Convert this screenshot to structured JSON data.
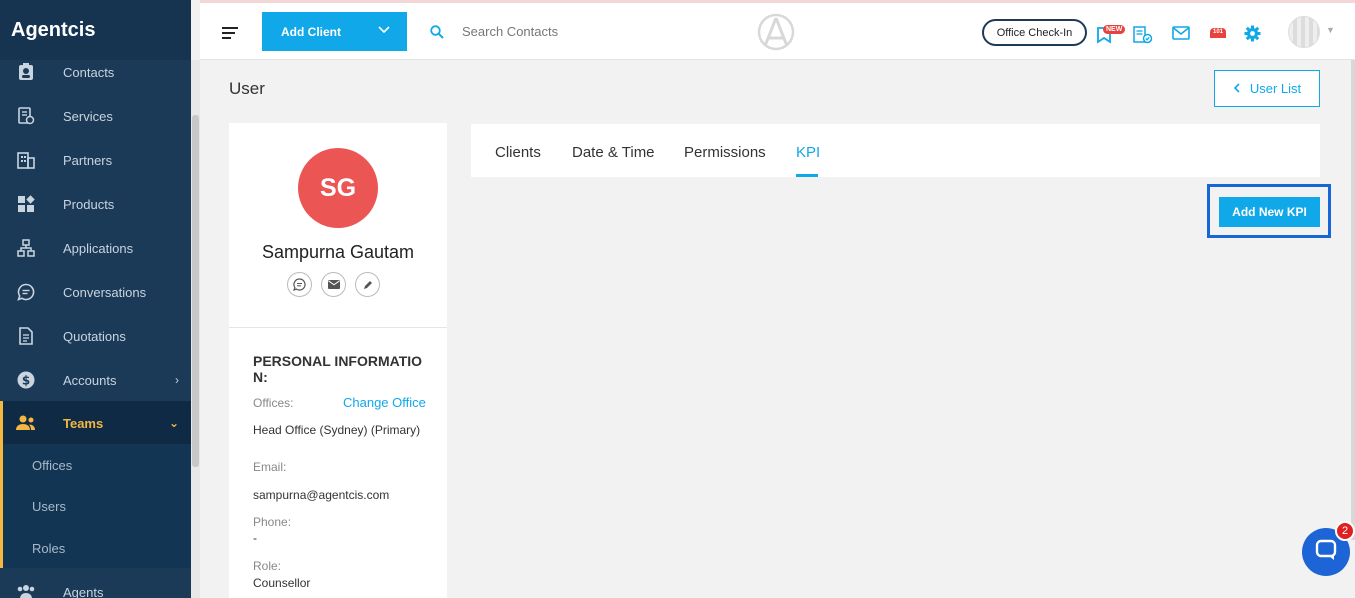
{
  "app": {
    "brand": "Agentcis"
  },
  "sidebar": {
    "items": [
      {
        "label": "Contacts",
        "icon": "contact-card-icon"
      },
      {
        "label": "Services",
        "icon": "services-icon"
      },
      {
        "label": "Partners",
        "icon": "building-icon"
      },
      {
        "label": "Products",
        "icon": "grid-icon"
      },
      {
        "label": "Applications",
        "icon": "hierarchy-icon"
      },
      {
        "label": "Conversations",
        "icon": "chat-icon"
      },
      {
        "label": "Quotations",
        "icon": "document-icon"
      },
      {
        "label": "Accounts",
        "icon": "dollar-icon"
      },
      {
        "label": "Teams",
        "icon": "team-icon",
        "active": true
      },
      {
        "label": "Agents",
        "icon": "people-icon"
      }
    ],
    "teams_sub": [
      "Offices",
      "Users",
      "Roles"
    ]
  },
  "header": {
    "add_client_label": "Add Client",
    "search_placeholder": "Search Contacts",
    "checkin_label": "Office Check-In",
    "new_badge": "NEW",
    "notif_badge": "101"
  },
  "main": {
    "page_title": "User",
    "user_list_label": "User List",
    "profile": {
      "initials": "SG",
      "name": "Sampurna Gautam",
      "avatar_color": "#eb5654",
      "section_title": "PERSONAL INFORMATION:",
      "offices_label": "Offices:",
      "change_office_label": "Change Office",
      "office_value": "Head Office (Sydney) (Primary)",
      "email_label": "Email:",
      "email_value": "sampurna@agentcis.com",
      "phone_label": "Phone:",
      "phone_value": "-",
      "role_label": "Role:",
      "role_value": "Counsellor"
    },
    "tabs": [
      {
        "label": "Clients"
      },
      {
        "label": "Date & Time"
      },
      {
        "label": "Permissions"
      },
      {
        "label": "KPI",
        "active": true
      }
    ],
    "add_kpi_label": "Add New KPI"
  },
  "chat": {
    "badge": "2"
  },
  "colors": {
    "accent": "#10a8e8",
    "sidebar": "#1b3a57",
    "active": "#f5b740"
  }
}
